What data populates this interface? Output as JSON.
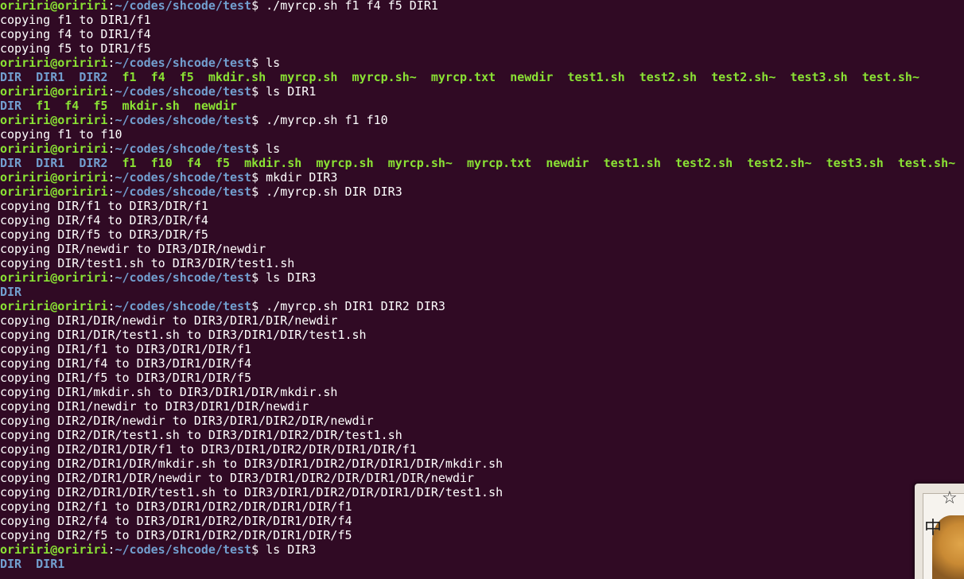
{
  "terminal": {
    "prompt": {
      "user": "oririri@oririri",
      "colon": ":",
      "path": "~/codes/shcode/test",
      "symbol": "$ "
    },
    "colors": {
      "background": "#300a24",
      "prompt_user": "#8ae234",
      "prompt_path": "#729fcf",
      "directory": "#729fcf",
      "executable": "#8ae234",
      "text": "#ffffff"
    },
    "lines": [
      {
        "kind": "cmd",
        "text": "./myrcp.sh f1 f4 f5 DIR1"
      },
      {
        "kind": "out",
        "text": "copying f1 to DIR1/f1"
      },
      {
        "kind": "out",
        "text": "copying f4 to DIR1/f4"
      },
      {
        "kind": "out",
        "text": "copying f5 to DIR1/f5"
      },
      {
        "kind": "cmd",
        "text": "ls"
      },
      {
        "kind": "ls",
        "items": [
          {
            "n": "DIR",
            "t": "dir"
          },
          {
            "n": "DIR1",
            "t": "dir"
          },
          {
            "n": "DIR2",
            "t": "dir"
          },
          {
            "n": "f1",
            "t": "exec"
          },
          {
            "n": "f4",
            "t": "exec"
          },
          {
            "n": "f5",
            "t": "exec"
          },
          {
            "n": "mkdir.sh",
            "t": "exec"
          },
          {
            "n": "myrcp.sh",
            "t": "exec"
          },
          {
            "n": "myrcp.sh~",
            "t": "exec"
          },
          {
            "n": "myrcp.txt",
            "t": "exec"
          },
          {
            "n": "newdir",
            "t": "exec"
          },
          {
            "n": "test1.sh",
            "t": "exec"
          },
          {
            "n": "test2.sh",
            "t": "exec"
          },
          {
            "n": "test2.sh~",
            "t": "exec"
          },
          {
            "n": "test3.sh",
            "t": "exec"
          },
          {
            "n": "test.sh~",
            "t": "exec"
          }
        ]
      },
      {
        "kind": "cmd",
        "text": "ls DIR1"
      },
      {
        "kind": "ls",
        "items": [
          {
            "n": "DIR",
            "t": "dir"
          },
          {
            "n": "f1",
            "t": "exec"
          },
          {
            "n": "f4",
            "t": "exec"
          },
          {
            "n": "f5",
            "t": "exec"
          },
          {
            "n": "mkdir.sh",
            "t": "exec"
          },
          {
            "n": "newdir",
            "t": "exec"
          }
        ]
      },
      {
        "kind": "cmd",
        "text": "./myrcp.sh f1 f10"
      },
      {
        "kind": "out",
        "text": "copying f1 to f10"
      },
      {
        "kind": "cmd",
        "text": "ls"
      },
      {
        "kind": "ls",
        "items": [
          {
            "n": "DIR",
            "t": "dir"
          },
          {
            "n": "DIR1",
            "t": "dir"
          },
          {
            "n": "DIR2",
            "t": "dir"
          },
          {
            "n": "f1",
            "t": "exec"
          },
          {
            "n": "f10",
            "t": "exec"
          },
          {
            "n": "f4",
            "t": "exec"
          },
          {
            "n": "f5",
            "t": "exec"
          },
          {
            "n": "mkdir.sh",
            "t": "exec"
          },
          {
            "n": "myrcp.sh",
            "t": "exec"
          },
          {
            "n": "myrcp.sh~",
            "t": "exec"
          },
          {
            "n": "myrcp.txt",
            "t": "exec"
          },
          {
            "n": "newdir",
            "t": "exec"
          },
          {
            "n": "test1.sh",
            "t": "exec"
          },
          {
            "n": "test2.sh",
            "t": "exec"
          },
          {
            "n": "test2.sh~",
            "t": "exec"
          },
          {
            "n": "test3.sh",
            "t": "exec"
          },
          {
            "n": "test.sh~",
            "t": "exec"
          }
        ]
      },
      {
        "kind": "cmd",
        "text": "mkdir DIR3"
      },
      {
        "kind": "cmd",
        "text": "./myrcp.sh DIR DIR3"
      },
      {
        "kind": "out",
        "text": "copying DIR/f1 to DIR3/DIR/f1"
      },
      {
        "kind": "out",
        "text": "copying DIR/f4 to DIR3/DIR/f4"
      },
      {
        "kind": "out",
        "text": "copying DIR/f5 to DIR3/DIR/f5"
      },
      {
        "kind": "out",
        "text": "copying DIR/newdir to DIR3/DIR/newdir"
      },
      {
        "kind": "out",
        "text": "copying DIR/test1.sh to DIR3/DIR/test1.sh"
      },
      {
        "kind": "cmd",
        "text": "ls DIR3"
      },
      {
        "kind": "ls",
        "items": [
          {
            "n": "DIR",
            "t": "dir"
          }
        ]
      },
      {
        "kind": "cmd",
        "text": "./myrcp.sh DIR1 DIR2 DIR3"
      },
      {
        "kind": "out",
        "text": "copying DIR1/DIR/newdir to DIR3/DIR1/DIR/newdir"
      },
      {
        "kind": "out",
        "text": "copying DIR1/DIR/test1.sh to DIR3/DIR1/DIR/test1.sh"
      },
      {
        "kind": "out",
        "text": "copying DIR1/f1 to DIR3/DIR1/DIR/f1"
      },
      {
        "kind": "out",
        "text": "copying DIR1/f4 to DIR3/DIR1/DIR/f4"
      },
      {
        "kind": "out",
        "text": "copying DIR1/f5 to DIR3/DIR1/DIR/f5"
      },
      {
        "kind": "out",
        "text": "copying DIR1/mkdir.sh to DIR3/DIR1/DIR/mkdir.sh"
      },
      {
        "kind": "out",
        "text": "copying DIR1/newdir to DIR3/DIR1/DIR/newdir"
      },
      {
        "kind": "out",
        "text": "copying DIR2/DIR/newdir to DIR3/DIR1/DIR2/DIR/newdir"
      },
      {
        "kind": "out",
        "text": "copying DIR2/DIR/test1.sh to DIR3/DIR1/DIR2/DIR/test1.sh"
      },
      {
        "kind": "out",
        "text": "copying DIR2/DIR1/DIR/f1 to DIR3/DIR1/DIR2/DIR/DIR1/DIR/f1"
      },
      {
        "kind": "out",
        "text": "copying DIR2/DIR1/DIR/mkdir.sh to DIR3/DIR1/DIR2/DIR/DIR1/DIR/mkdir.sh"
      },
      {
        "kind": "out",
        "text": "copying DIR2/DIR1/DIR/newdir to DIR3/DIR1/DIR2/DIR/DIR1/DIR/newdir"
      },
      {
        "kind": "out",
        "text": "copying DIR2/DIR1/DIR/test1.sh to DIR3/DIR1/DIR2/DIR/DIR1/DIR/test1.sh"
      },
      {
        "kind": "out",
        "text": "copying DIR2/f1 to DIR3/DIR1/DIR2/DIR/DIR1/DIR/f1"
      },
      {
        "kind": "out",
        "text": "copying DIR2/f4 to DIR3/DIR1/DIR2/DIR/DIR1/DIR/f4"
      },
      {
        "kind": "out",
        "text": "copying DIR2/f5 to DIR3/DIR1/DIR2/DIR/DIR1/DIR/f5"
      },
      {
        "kind": "cmd",
        "text": "ls DIR3"
      },
      {
        "kind": "ls",
        "items": [
          {
            "n": "DIR",
            "t": "dir"
          },
          {
            "n": "DIR1",
            "t": "dir"
          }
        ]
      }
    ]
  },
  "corner_thumbnail": {
    "star_icon": "☆",
    "glyph": "中"
  }
}
